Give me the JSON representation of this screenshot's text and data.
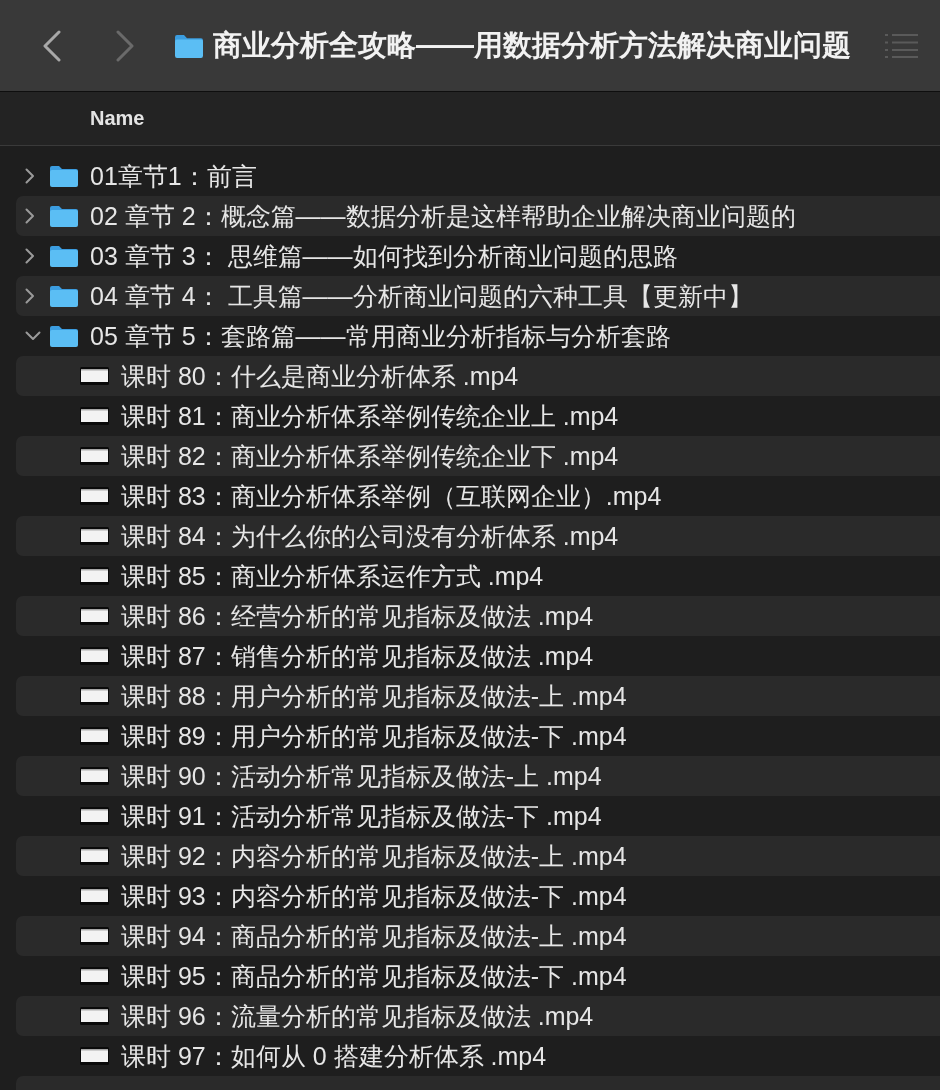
{
  "toolbar": {
    "back": {
      "disabled": false
    },
    "forward": {
      "disabled": true
    },
    "title": "商业分析全攻略——用数据分析方法解决商业问题"
  },
  "columns": [
    {
      "label": "Name"
    }
  ],
  "items": [
    {
      "kind": "folder",
      "name": "01章节1：前言",
      "expanded": false
    },
    {
      "kind": "folder",
      "name": "02 章节 2：概念篇——数据分析是这样帮助企业解决商业问题的",
      "expanded": false
    },
    {
      "kind": "folder",
      "name": "03 章节 3： 思维篇——如何找到分析商业问题的思路",
      "expanded": false
    },
    {
      "kind": "folder",
      "name": "04 章节 4： 工具篇——分析商业问题的六种工具【更新中】",
      "expanded": false
    },
    {
      "kind": "folder",
      "name": "05 章节 5：套路篇——常用商业分析指标与分析套路",
      "expanded": true,
      "children": [
        {
          "kind": "video",
          "name": "课时 80：什么是商业分析体系 .mp4"
        },
        {
          "kind": "video",
          "name": "课时 81：商业分析体系举例传统企业上 .mp4"
        },
        {
          "kind": "video",
          "name": "课时 82：商业分析体系举例传统企业下 .mp4"
        },
        {
          "kind": "video",
          "name": "课时 83：商业分析体系举例（互联网企业）.mp4"
        },
        {
          "kind": "video",
          "name": "课时 84：为什么你的公司没有分析体系 .mp4"
        },
        {
          "kind": "video",
          "name": "课时 85：商业分析体系运作方式 .mp4"
        },
        {
          "kind": "video",
          "name": "课时 86：经营分析的常见指标及做法 .mp4"
        },
        {
          "kind": "video",
          "name": "课时 87：销售分析的常见指标及做法 .mp4"
        },
        {
          "kind": "video",
          "name": "课时 88：用户分析的常见指标及做法-上 .mp4"
        },
        {
          "kind": "video",
          "name": "课时 89：用户分析的常见指标及做法-下 .mp4"
        },
        {
          "kind": "video",
          "name": "课时 90：活动分析常见指标及做法-上 .mp4"
        },
        {
          "kind": "video",
          "name": "课时 91：活动分析常见指标及做法-下 .mp4"
        },
        {
          "kind": "video",
          "name": "课时 92：内容分析的常见指标及做法-上 .mp4"
        },
        {
          "kind": "video",
          "name": "课时 93：内容分析的常见指标及做法-下 .mp4"
        },
        {
          "kind": "video",
          "name": "课时 94：商品分析的常见指标及做法-上 .mp4"
        },
        {
          "kind": "video",
          "name": "课时 95：商品分析的常见指标及做法-下 .mp4"
        },
        {
          "kind": "video",
          "name": "课时 96：流量分析的常见指标及做法 .mp4"
        },
        {
          "kind": "video",
          "name": "课时 97：如何从 0 搭建分析体系 .mp4"
        }
      ]
    }
  ]
}
